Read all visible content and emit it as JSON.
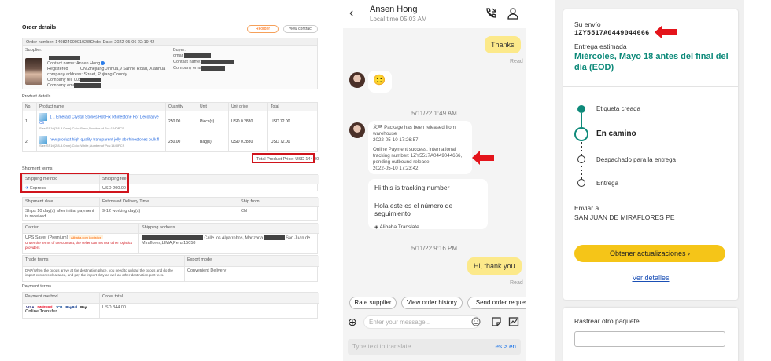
{
  "order": {
    "title": "Order details",
    "reorder_label": "Reorder",
    "view_contract_label": "View contract",
    "order_number_label": "Order number: 140824000010235",
    "order_date_label": "Order Date: 2022-05-06 22:19:42",
    "supplier_label": "Supplier:",
    "buyer_label": "Buyer:",
    "buyer_name_prefix": "omar",
    "contact_name": "Contact name: Ansen Hong",
    "registered": "Registered",
    "registered_value": "CN,Zhejiang,Jinhua,9 Sanhe Road, Xianhua",
    "company_address": "company address:",
    "company_address_value": "Street, Pujiang County",
    "company_tel": "Company tel: 0086-",
    "company_email": "Company email:",
    "buyer_contact": "Contact name:",
    "buyer_email": "Company email:",
    "product_details_label": "Product details",
    "columns": [
      "No.",
      "Product name",
      "Quantity",
      "Unit",
      "Unit price",
      "Total"
    ],
    "products": [
      {
        "no": "1",
        "name": "1T. Emerald Crystal Stones Hot Fix Rhinestone For Decorative Cli",
        "sub": "Size:SS10(2.8-3.0mm) Color:Black,Number of Pcs:1440PCS",
        "qty": "250.00",
        "unit": "Piece(s)",
        "price": "USD 0.2880",
        "total": "USD 72.00"
      },
      {
        "no": "2",
        "name": "new product high quality transparent jelly ab rhinestones bulk fl",
        "sub": "Size:SS10(2.8-3.0mm) Color:White,Number of Pcs:1440PCS",
        "qty": "250.00",
        "unit": "Bag(s)",
        "price": "USD 0.2880",
        "total": "USD 72.00"
      }
    ],
    "total_product_price": "Total Product Price: USD 144.00",
    "shipment_terms_label": "Shipment terms",
    "shipping_method_h": "Shipping method",
    "shipping_fee_h": "Shipping fee",
    "shipping_method": "Express",
    "shipping_fee": "USD 200.00",
    "shipment_date_h": "Shipment date",
    "eta_h": "Estimated Delivery Time",
    "ship_from_h": "Ship from",
    "shipment_date": "Ships 10 day(s) after initial payment is received",
    "eta": "9-12 working day(s)",
    "ship_from": "CN",
    "carrier_h": "Carrier",
    "shipping_address_h": "Shipping address",
    "carrier": "UPS Saver (Premium)",
    "carrier_tag": "Alibaba.com Logistics",
    "carrier_note": "Under the terms of the contract, the seller can not use other logistics providers",
    "address_a": "Calle los Algarrobos, Manzana",
    "address_b": "San Juan de",
    "address_c": "Miraflores,LIMA,Peru,15058",
    "trade_terms_h": "Trade terms",
    "export_mode_h": "Export mode",
    "trade_terms": "DAP(When the goods arrive at the destination place, you need to unload the goods and do the import customs clearance, and pay the import duty as well as other destination port fees.",
    "export_mode": "Convenient Delivery",
    "payment_terms_label": "Payment terms",
    "payment_method_h": "Payment method",
    "order_total_h": "Order total",
    "payment_logos": [
      "VISA",
      "mastercard",
      "JCB",
      "PayPal",
      "Pay"
    ],
    "online_transfer": "Online Transfer",
    "order_total": "USD 344.00"
  },
  "chat": {
    "contact_name": "Ansen Hong",
    "local_time": "Local time 05:03 AM",
    "msg_thanks": "Thanks",
    "read1": "Read",
    "emoji": "🙂",
    "stamp1": "5/11/22 1:49 AM",
    "sys_cn": "义马 Package has been released from warehouse",
    "sys_cn_time": "2022-05-10 17:26:57",
    "sys_payment": "Online Payment success, international tracking number: 1ZY5517A0449044666, pending outbound release",
    "sys_payment_time": "2022-05-10 17:23:42",
    "msg_tracking": "Hi this is tracking number",
    "msg_tracking_es": "Hola este es el número de seguimiento",
    "alibaba_translate": "Alibaba Translate",
    "stamp2": "5/11/22 9:16 PM",
    "msg_hi_thanks": "Hi, thank you",
    "read2": "Read",
    "chip_rate": "Rate supplier",
    "chip_history": "View order history",
    "chip_send": "Send order request",
    "input_placeholder": "Enter your message...",
    "translate_placeholder": "Type text to translate...",
    "lang_pair": "es > en"
  },
  "tracking": {
    "su_envio": "Su envío",
    "tracking_number": "1ZY5517A0449044666",
    "entrega_estimada": "Entrega estimada",
    "estimated_date": "Miércoles, Mayo 18 antes del final del día (EOD)",
    "steps": [
      "Etiqueta creada",
      "En camino",
      "Despachado para la entrega",
      "Entrega"
    ],
    "enviar_a": "Enviar a",
    "destination": "SAN JUAN DE MIRAFLORES PE",
    "cta_label": "Obtener actualizaciones",
    "details_link": "Ver detalles",
    "track_other": "Rastrear otro paquete"
  },
  "colors": {
    "highlight_red": "#d0141c",
    "chat_mine": "#fce98a",
    "tracking_green": "#0e8a7a",
    "ups_yellow": "#f5c518"
  }
}
